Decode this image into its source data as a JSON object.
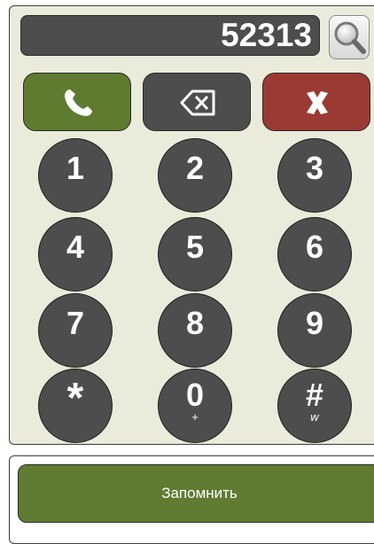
{
  "display": {
    "number": "52313"
  },
  "actions": {
    "call": {
      "icon": "phone-icon",
      "color": "#5e7b2f"
    },
    "backspace": {
      "icon": "backspace-icon",
      "color": "#4d4d4d"
    },
    "hangup": {
      "icon": "close-icon",
      "color": "#9b3a32"
    }
  },
  "search": {
    "icon": "search-icon"
  },
  "keypad": [
    {
      "digit": "1",
      "sub": ""
    },
    {
      "digit": "2",
      "sub": ""
    },
    {
      "digit": "3",
      "sub": ""
    },
    {
      "digit": "4",
      "sub": ""
    },
    {
      "digit": "5",
      "sub": ""
    },
    {
      "digit": "6",
      "sub": ""
    },
    {
      "digit": "7",
      "sub": ""
    },
    {
      "digit": "8",
      "sub": ""
    },
    {
      "digit": "9",
      "sub": ""
    },
    {
      "digit": "*",
      "sub": ""
    },
    {
      "digit": "0",
      "sub": "+"
    },
    {
      "digit": "#",
      "sub": "w"
    }
  ],
  "save": {
    "label": "Запомнить",
    "color": "#607b32"
  }
}
